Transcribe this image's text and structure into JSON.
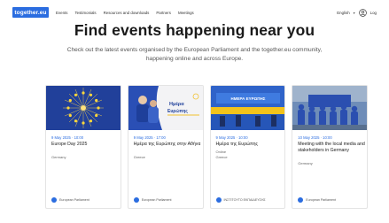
{
  "header": {
    "logo": "together.eu",
    "nav": [
      "Events",
      "Testimonials",
      "Resources and downloads",
      "Partners",
      "Meetings"
    ],
    "language": "English",
    "login": "Log"
  },
  "main": {
    "title": "Find events happening near you",
    "subtitle": "Check out the latest events organised by the European Parliament and the together.eu community, happening online and across Europe."
  },
  "cards": [
    {
      "date": "9 May 2025 · 10:00",
      "title": "Europe Day 2025",
      "locations": [
        "Germany"
      ],
      "organiser": "European Parliament",
      "image": "eu-flag-stars"
    },
    {
      "date": "9 May 2025 · 17:00",
      "title": "Ημέρα της Ευρώπης στην Αθήνα",
      "locations": [
        "Greece"
      ],
      "organiser": "European Parliament",
      "image": "europe-day-poster"
    },
    {
      "date": "9 May 2025 · 10:00",
      "title": "Ημέρα της Ευρώπης",
      "locations": [
        "Online",
        "Greece"
      ],
      "organiser": "ΙΝΣΤΙΤΟΥΤΟ ΕΚΠΑΙΔΕΥΣΗΣ",
      "image": "stage-yellow-blue"
    },
    {
      "date": "10 May 2025 · 10:00",
      "title": "Meeting with the local media and stakeholders in Germany",
      "locations": [
        "Germany"
      ],
      "organiser": "European Parliament",
      "image": "group-photo"
    }
  ]
}
